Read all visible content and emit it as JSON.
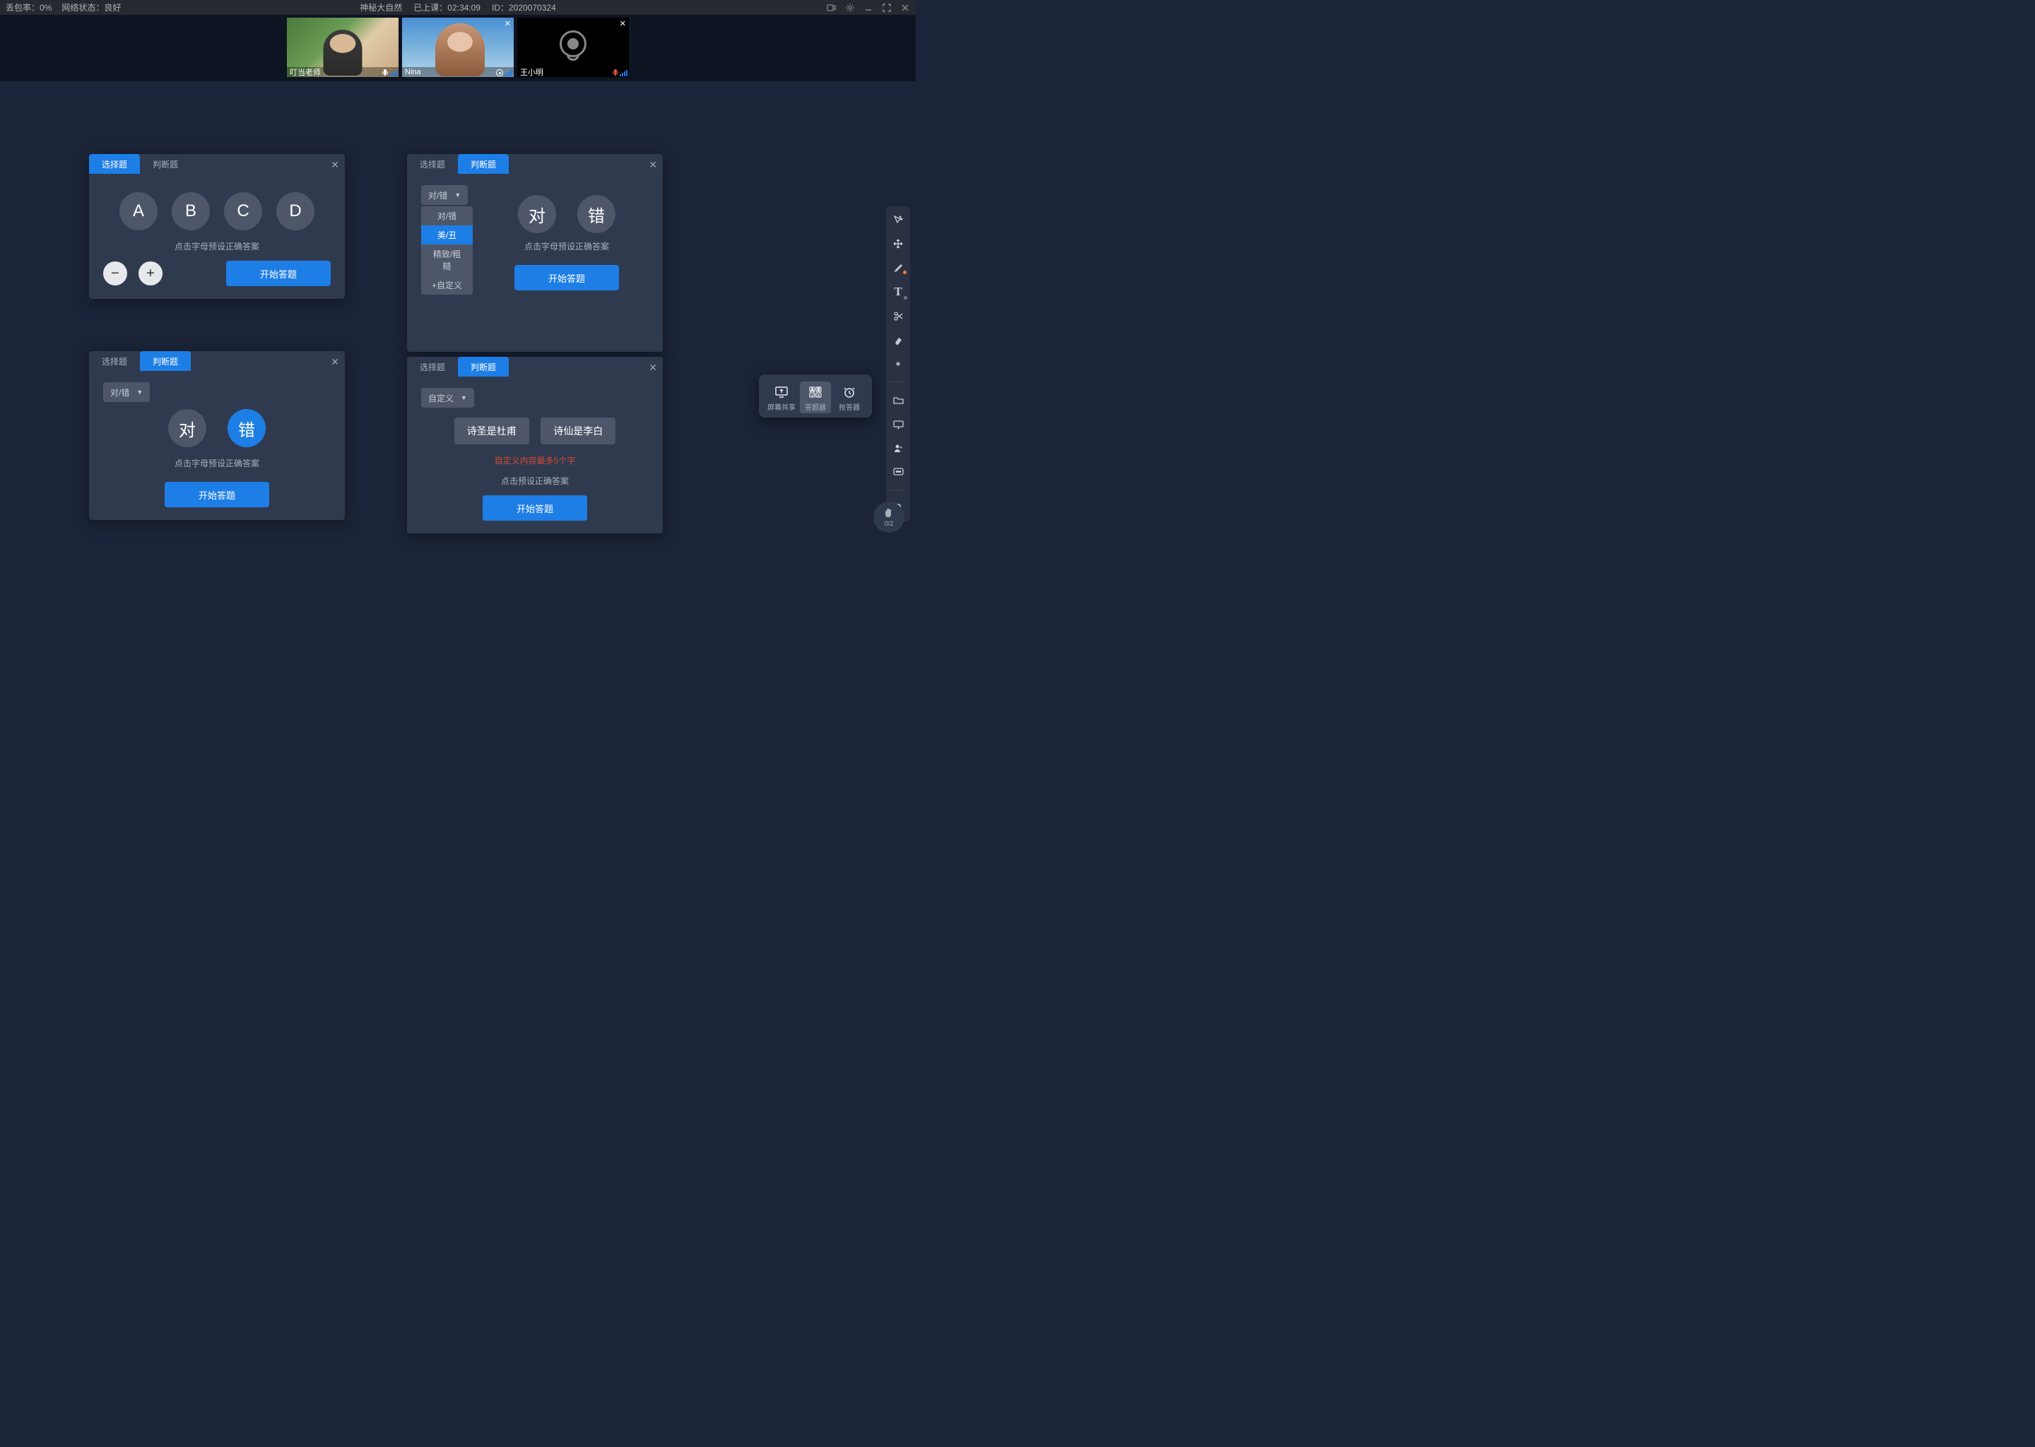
{
  "topbar": {
    "packet_loss_label": "丢包率：0%",
    "network_label": "网络状态：良好",
    "title": "神秘大自然",
    "elapsed_label": "已上课：",
    "elapsed_value": "02:34:09",
    "id_label": "ID：",
    "id_value": "2020070324"
  },
  "videos": [
    {
      "name": "叮当老师",
      "camera": "on",
      "closable": false
    },
    {
      "name": "Nina",
      "camera": "on",
      "closable": true
    },
    {
      "name": "王小明",
      "camera": "off",
      "closable": true
    }
  ],
  "panel1": {
    "tab_choice": "选择题",
    "tab_judge": "判断题",
    "options": [
      "A",
      "B",
      "C",
      "D"
    ],
    "hint": "点击字母预设正确答案",
    "start": "开始答题"
  },
  "panel2": {
    "tab_choice": "选择题",
    "tab_judge": "判断题",
    "select_label": "对/错",
    "dropdown": [
      "对/错",
      "美/丑",
      "精致/粗糙",
      "+自定义"
    ],
    "opt1": "对",
    "opt2": "错",
    "hint": "点击字母预设正确答案",
    "start": "开始答题"
  },
  "panel3": {
    "tab_choice": "选择题",
    "tab_judge": "判断题",
    "select_label": "对/错",
    "opt1": "对",
    "opt2": "错",
    "hint": "点击字母预设正确答案",
    "start": "开始答题"
  },
  "panel4": {
    "tab_choice": "选择题",
    "tab_judge": "判断题",
    "select_label": "自定义",
    "opt1": "诗圣是杜甫",
    "opt2": "诗仙是李白",
    "err": "自定义内容最多5个字",
    "hint": "点击预设正确答案",
    "start": "开始答题"
  },
  "tray": {
    "share": "屏幕共享",
    "quiz": "答题器",
    "buzzer": "抢答器"
  },
  "hand": {
    "count": "0/2"
  }
}
